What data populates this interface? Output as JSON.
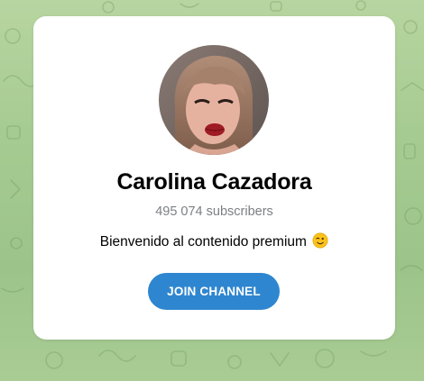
{
  "channel": {
    "name": "Carolina Cazadora",
    "subscribers": "495 074 subscribers",
    "description": "Bienvenido al contenido premium",
    "description_emoji": "winking-face",
    "join_label": "JOIN CHANNEL"
  },
  "colors": {
    "background": "#a8cc94",
    "card": "#ffffff",
    "button": "#2e86d0",
    "subscribers_text": "#7b7f84"
  },
  "icons": {
    "avatar": "profile-photo",
    "emoji": "winking-face-emoji"
  }
}
